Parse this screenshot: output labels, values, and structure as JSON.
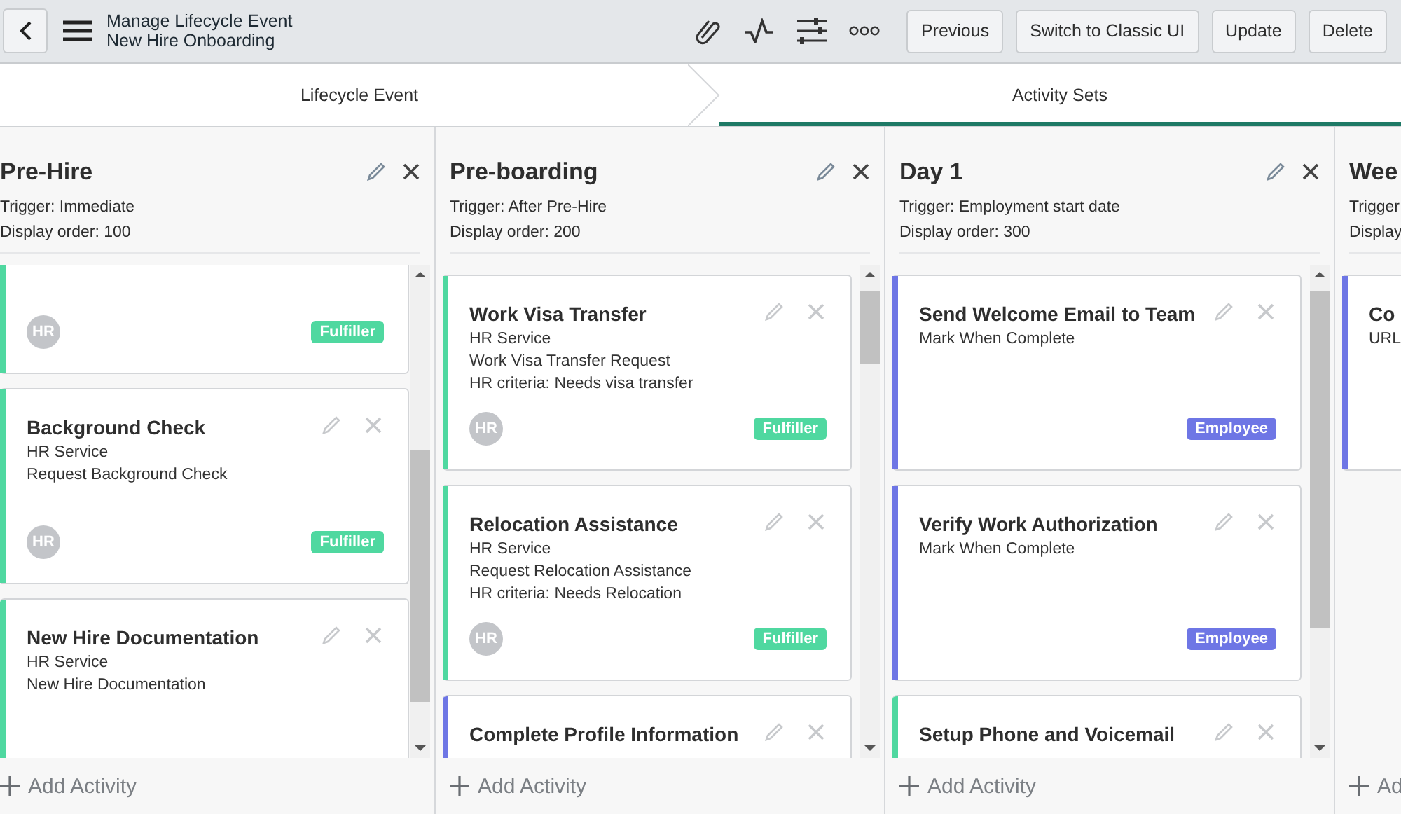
{
  "header": {
    "title": "Manage Lifecycle Event",
    "subtitle": "New Hire Onboarding",
    "buttons": [
      "Previous",
      "Switch to Classic UI",
      "Update",
      "Delete"
    ]
  },
  "tabs": [
    {
      "label": "Lifecycle Event",
      "selected": false
    },
    {
      "label": "Activity Sets",
      "selected": true
    }
  ],
  "columns": [
    {
      "kind": "full",
      "title": "Pre-Hire",
      "trigger": "Trigger: Immediate",
      "display_order": "Display order: 100",
      "add_label": "Add Activity",
      "cards": [
        {
          "color": "#4fd8a0",
          "avatar": "HR",
          "badge": {
            "label": "Fulfiller",
            "color": "#4fd8a0"
          }
        },
        {
          "title": "Background Check",
          "lines": [
            "HR Service",
            "Request Background Check"
          ],
          "color": "#4fd8a0",
          "avatar": "HR",
          "badge": {
            "label": "Fulfiller",
            "color": "#4fd8a0"
          }
        },
        {
          "title": "New Hire Documentation",
          "lines": [
            "HR Service",
            "New Hire Documentation"
          ],
          "color": "#4fd8a0"
        }
      ]
    },
    {
      "kind": "full",
      "title": "Pre-boarding",
      "trigger": "Trigger: After Pre-Hire",
      "display_order": "Display order: 200",
      "add_label": "Add Activity",
      "cards": [
        {
          "title": "Work Visa Transfer",
          "lines": [
            "HR Service",
            "Work Visa Transfer Request",
            "HR criteria: Needs visa transfer"
          ],
          "color": "#4fd8a0",
          "avatar": "HR",
          "badge": {
            "label": "Fulfiller",
            "color": "#4fd8a0"
          }
        },
        {
          "title": "Relocation Assistance",
          "lines": [
            "HR Service",
            "Request Relocation Assistance",
            "HR criteria: Needs Relocation"
          ],
          "color": "#4fd8a0",
          "avatar": "HR",
          "badge": {
            "label": "Fulfiller",
            "color": "#4fd8a0"
          }
        },
        {
          "title": "Complete Profile Information",
          "color": "#6e76e5"
        }
      ]
    },
    {
      "kind": "full",
      "title": "Day 1",
      "trigger": "Trigger: Employment start date",
      "display_order": "Display order: 300",
      "add_label": "Add Activity",
      "cards": [
        {
          "title": "Send Welcome Email to Team",
          "lines": [
            "Mark When Complete"
          ],
          "color": "#6e76e5",
          "badge": {
            "label": "Employee",
            "color": "#6e76e5"
          }
        },
        {
          "title": "Verify Work Authorization",
          "lines": [
            "Mark When Complete"
          ],
          "color": "#6e76e5",
          "badge": {
            "label": "Employee",
            "color": "#6e76e5"
          }
        },
        {
          "title": "Setup Phone and Voicemail",
          "color": "#4fd8a0"
        }
      ]
    },
    {
      "kind": "cut",
      "title": "Wee",
      "trigger": "Trigger:",
      "display_order": "Display",
      "add_label": "Ad",
      "cards": [
        {
          "title": "Co",
          "lines": [
            "URL"
          ],
          "color": "#6e76e5"
        }
      ]
    }
  ]
}
